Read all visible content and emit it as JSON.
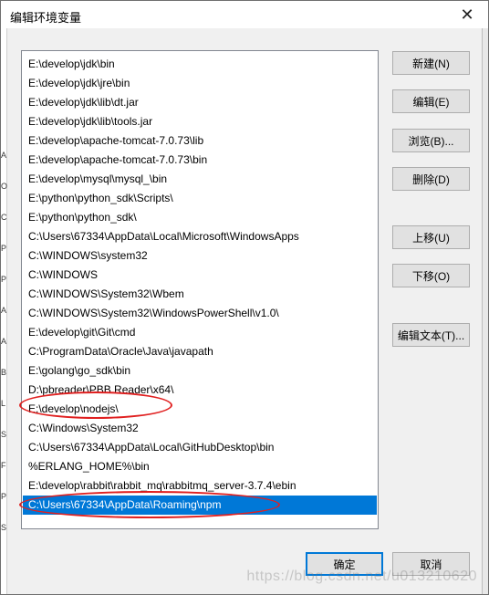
{
  "window": {
    "title": "编辑环境变量",
    "close_glyph": "✕"
  },
  "background_chars": [
    "",
    "A",
    "O",
    "C",
    "P",
    "P",
    "A",
    "A",
    "B",
    "L",
    "S",
    "F",
    "P",
    "S"
  ],
  "list": {
    "items": [
      "E:\\develop\\jdk\\bin",
      "E:\\develop\\jdk\\jre\\bin",
      "E:\\develop\\jdk\\lib\\dt.jar",
      "E:\\develop\\jdk\\lib\\tools.jar",
      "E:\\develop\\apache-tomcat-7.0.73\\lib",
      "E:\\develop\\apache-tomcat-7.0.73\\bin",
      "E:\\develop\\mysql\\mysql_\\bin",
      "E:\\python\\python_sdk\\Scripts\\",
      "E:\\python\\python_sdk\\",
      "C:\\Users\\67334\\AppData\\Local\\Microsoft\\WindowsApps",
      "C:\\WINDOWS\\system32",
      "C:\\WINDOWS",
      "C:\\WINDOWS\\System32\\Wbem",
      "C:\\WINDOWS\\System32\\WindowsPowerShell\\v1.0\\",
      "E:\\develop\\git\\Git\\cmd",
      "C:\\ProgramData\\Oracle\\Java\\javapath",
      "E:\\golang\\go_sdk\\bin",
      "D:\\pbreader\\PBB Reader\\x64\\",
      "E:\\develop\\nodejs\\",
      "C:\\Windows\\System32",
      "C:\\Users\\67334\\AppData\\Local\\GitHubDesktop\\bin",
      "%ERLANG_HOME%\\bin",
      "E:\\develop\\rabbit\\rabbit_mq\\rabbitmq_server-3.7.4\\ebin",
      "C:\\Users\\67334\\AppData\\Roaming\\npm"
    ],
    "selected_index": 23,
    "highlighted_indices": [
      18,
      23
    ]
  },
  "buttons": {
    "new": "新建(N)",
    "edit": "编辑(E)",
    "browse": "浏览(B)...",
    "delete": "删除(D)",
    "move_up": "上移(U)",
    "move_down": "下移(O)",
    "edit_text": "编辑文本(T)...",
    "ok": "确定",
    "cancel": "取消"
  },
  "watermark": "https://blog.csdn.net/u013210620",
  "colors": {
    "selection": "#0078d7",
    "annotation_ring": "#e02020"
  }
}
